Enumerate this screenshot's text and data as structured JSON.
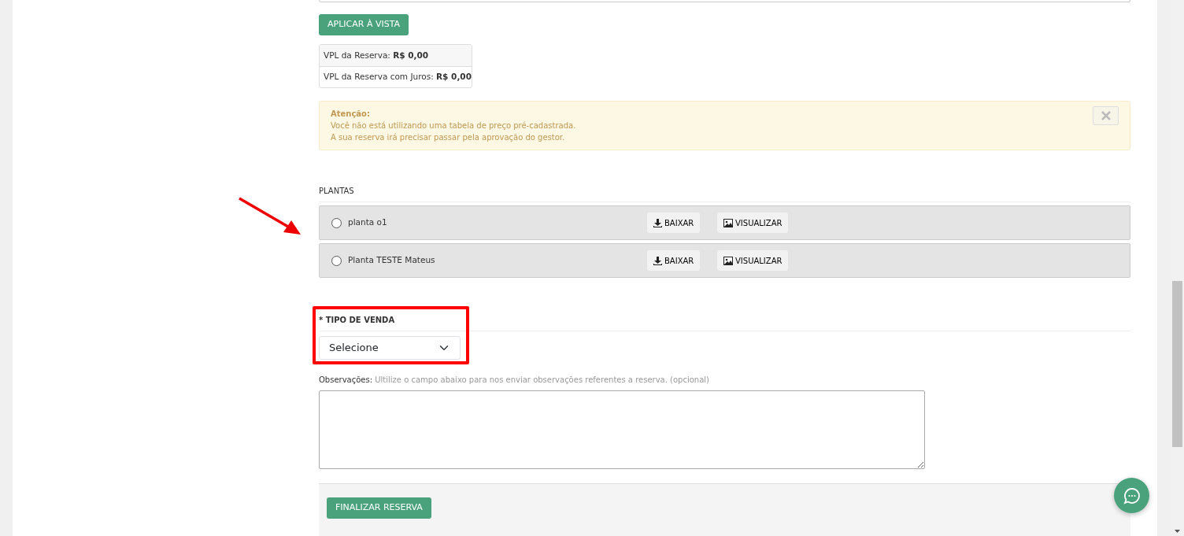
{
  "apply_button": "APLICAR À VISTA",
  "summary": [
    {
      "label": "VPL da Reserva:",
      "value": "R$ 0,00"
    },
    {
      "label": "VPL da Reserva com Juros:",
      "value": "R$ 0,00"
    }
  ],
  "alert": {
    "title": "Atenção:",
    "lines": [
      "Você não está utilizando uma tabela de preço pré-cadastrada.",
      "A sua reserva irá precisar passar pela aprovação do gestor."
    ]
  },
  "plans": {
    "heading": "PLANTAS",
    "items": [
      {
        "name": "planta o1",
        "selected": false,
        "download": "BAIXAR",
        "view": "VISUALIZAR"
      },
      {
        "name": "Planta TESTE Mateus",
        "selected": false,
        "download": "BAIXAR",
        "view": "VISUALIZAR"
      }
    ]
  },
  "sale_type": {
    "label": "* TIPO DE VENDA",
    "value": "Selecione"
  },
  "notes": {
    "label": "Observações:",
    "hint": "Ultilize o campo abaixo para nos enviar observações referentes a reserva. (opcional)"
  },
  "finish_button": "FINALIZAR RESERVA"
}
